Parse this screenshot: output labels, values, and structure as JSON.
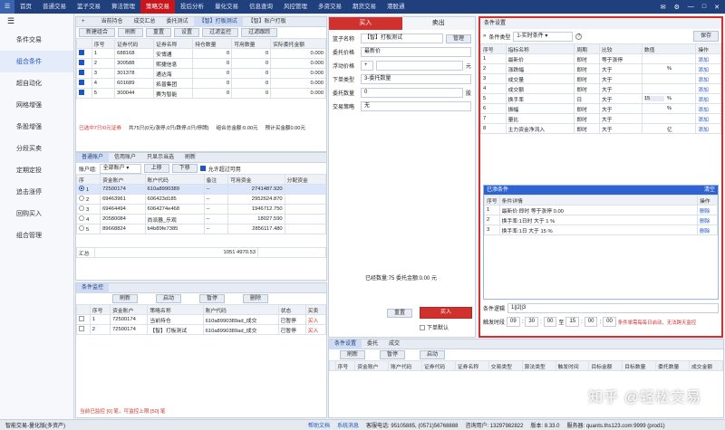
{
  "topnav": {
    "items": [
      "首页",
      "普通交易",
      "篮子交易",
      "算法管理",
      "策略交易",
      "投后分析",
      "量化交易",
      "信息查询",
      "风控管理",
      "多资交易",
      "期货交易",
      "港股通"
    ],
    "active_index": 4
  },
  "sidebar": {
    "items": [
      "条件交易",
      "组合条件",
      "超自动化",
      "网格增强",
      "条股增强",
      "分段买卖",
      "定期定投",
      "追击涨停",
      "回购买入",
      "组合管理"
    ],
    "active_index": 1
  },
  "strategy_panel": {
    "tabs": [
      "当前持仓",
      "成交汇总",
      "委托测试",
      "【智】打板测试",
      "【智】账户打板"
    ],
    "toolbar": [
      "新建组合",
      "刷新",
      "重置",
      "设置",
      "过滤监控",
      "过滤跟踪"
    ],
    "columns": [
      "序号",
      "证券代码",
      "证券名称",
      "持仓数量",
      "可用数量",
      "实际委托金额"
    ],
    "rows": [
      {
        "no": "1",
        "code": "688168",
        "name": "安博通",
        "qty": "0",
        "avail": "0",
        "amt": "0.000"
      },
      {
        "no": "2",
        "code": "300588",
        "name": "熙捷信息",
        "qty": "0",
        "avail": "0",
        "amt": "0.000"
      },
      {
        "no": "3",
        "code": "301378",
        "name": "通达海",
        "qty": "0",
        "avail": "0",
        "amt": "0.000"
      },
      {
        "no": "4",
        "code": "601689",
        "name": "拓普集团",
        "qty": "0",
        "avail": "0",
        "amt": "0.000"
      },
      {
        "no": "5",
        "code": "300044",
        "name": "赛为智能",
        "qty": "0",
        "avail": "0",
        "amt": "0.000"
      }
    ],
    "footer": [
      "已选中7只/0元证券",
      "共75只(0元/涨停,0只/跌停,0只/停牌)",
      "组合总金额:0.00元",
      "预计买金额0.00元"
    ]
  },
  "account_panel": {
    "tabs": [
      "普通账户",
      "信用账户",
      "只显示当选",
      "刷新"
    ],
    "account_label": "账户组:",
    "account_group": "全部账户",
    "buttons": [
      "上移",
      "下移"
    ],
    "over_limit_label": "允许超过可用",
    "columns": [
      "序",
      "资金账户",
      "账户代码",
      "备注",
      "可用资金",
      "分配资金"
    ],
    "rows": [
      {
        "no": "1",
        "acct": "72500174",
        "code": "610a8990389",
        "note": "--",
        "avail": "2741487.920",
        "alloc": ""
      },
      {
        "no": "2",
        "acct": "69463961",
        "code": "606423d185",
        "note": "--",
        "avail": "2952624.870",
        "alloc": ""
      },
      {
        "no": "3",
        "acct": "69464494",
        "code": "6064274e468",
        "note": "--",
        "avail": "1946712.750",
        "alloc": ""
      },
      {
        "no": "4",
        "acct": "20580084",
        "code": "尚派器_乐观",
        "note": "--",
        "avail": "18027.590",
        "alloc": ""
      },
      {
        "no": "5",
        "acct": "89668824",
        "code": "b4b89fe7385",
        "note": "--",
        "avail": "2856117.480",
        "alloc": ""
      }
    ],
    "summary_label": "汇总",
    "summary_value": "1051 4970.53"
  },
  "monitor_panel": {
    "tab": "条件监控",
    "buttons": [
      "刷新",
      "启动",
      "暂停",
      "删除"
    ],
    "columns": [
      "序号",
      "资金账户",
      "策略名称",
      "账户代码",
      "状态",
      "买卖"
    ],
    "rows": [
      {
        "no": "1",
        "acct": "72500174",
        "strategy": "当前持仓",
        "code": "610a8990389ad_成交",
        "status": "已暂停",
        "side": "买入"
      },
      {
        "no": "2",
        "acct": "72500174",
        "strategy": "【智】打板测试",
        "code": "610a8990389ad_成交",
        "status": "已暂停",
        "side": "买入"
      }
    ],
    "footer": "当前已监控 [0] 笔，可监控上限 [50] 笔"
  },
  "order_form": {
    "buy_tab": "买入",
    "sell_tab": "卖出",
    "basket_label": "篮子名称",
    "basket_value": "【智】打板测试",
    "manage": "管理",
    "price_label": "委托价格",
    "price_value": "最新价",
    "float_label": "浮动价格",
    "float_unit": "元",
    "order_type_label": "下单类型",
    "order_type_value": "3-委托数量",
    "qty_label": "委托数量",
    "qty_value": "0",
    "qty_unit": "股",
    "strategy_label": "交易策略",
    "strategy_value": "无",
    "summary": "已经数量:75  委托金额:0.00 元",
    "reset": "重置",
    "submit": "买入",
    "next_day": "下单默认"
  },
  "order_list": {
    "tabs": [
      "条件设置",
      "委托",
      "成交"
    ],
    "buttons": [
      "刷新",
      "暂停",
      "启动"
    ],
    "columns": [
      "序号",
      "资金账户",
      "账户代码",
      "证券代码",
      "证券名称",
      "交易类型",
      "算法类型",
      "触发时间",
      "目标金额",
      "目标数量",
      "委托数量",
      "成交金额"
    ]
  },
  "condition_panel": {
    "title": "条件设置",
    "type_label": "条件类型",
    "type_value": "1-实时条件",
    "save": "保存",
    "columns": [
      "序号",
      "指标名称",
      "周期",
      "比较",
      "数值",
      "操作"
    ],
    "rows": [
      {
        "no": "1",
        "name": "最新价",
        "period": "即时",
        "cmp": "等于涨停",
        "value": "",
        "unit": "",
        "op": "添加"
      },
      {
        "no": "2",
        "name": "涨跌幅",
        "period": "即时",
        "cmp": "大于",
        "value": "",
        "unit": "%",
        "op": "添加"
      },
      {
        "no": "3",
        "name": "成交量",
        "period": "即时",
        "cmp": "大于",
        "value": "",
        "unit": "",
        "op": "添加"
      },
      {
        "no": "4",
        "name": "成交额",
        "period": "即时",
        "cmp": "大于",
        "value": "",
        "unit": "",
        "op": "添加"
      },
      {
        "no": "5",
        "name": "换手率",
        "period": "日",
        "cmp": "大于",
        "value": "15",
        "unit": "%",
        "op": "添加"
      },
      {
        "no": "6",
        "name": "振幅",
        "period": "即时",
        "cmp": "大于",
        "value": "",
        "unit": "%",
        "op": "添加"
      },
      {
        "no": "7",
        "name": "量比",
        "period": "即时",
        "cmp": "大于",
        "value": "",
        "unit": "",
        "op": "添加"
      },
      {
        "no": "8",
        "name": "主力资金净流入",
        "period": "即时",
        "cmp": "大于",
        "value": "",
        "unit": "亿",
        "op": "添加"
      }
    ],
    "added_title": "已添条件",
    "clear": "清空",
    "added_columns": [
      "序号",
      "条件详情",
      "操作"
    ],
    "added_rows": [
      {
        "no": "1",
        "detail": "最新价:即时 等于涨停 0.00",
        "op": "删除"
      },
      {
        "no": "2",
        "detail": "换手率:1日时 大于 1 %",
        "op": "删除"
      },
      {
        "no": "3",
        "detail": "换手率:1日 大于 15 %",
        "op": "删除"
      }
    ],
    "logic_label": "条件逻辑",
    "logic_value": "1||2||3",
    "time_label": "触发时段",
    "time_start": [
      "09",
      "30",
      "00"
    ],
    "time_end": [
      "15",
      "00",
      "00"
    ],
    "note": "条件单需每每日启动，无法跨天监控"
  },
  "statusbar": {
    "left": "智能交易-量化版(多资产)",
    "items": [
      "帮助文档",
      "系统消息",
      "客服电话: 95105885, (0571)56768888",
      "咨询用户: 13297982822",
      "版本: 8.33.0",
      "服务器: quants.ths123.com:9999 (prod1)"
    ]
  },
  "watermark": "知乎 @轻松交易"
}
